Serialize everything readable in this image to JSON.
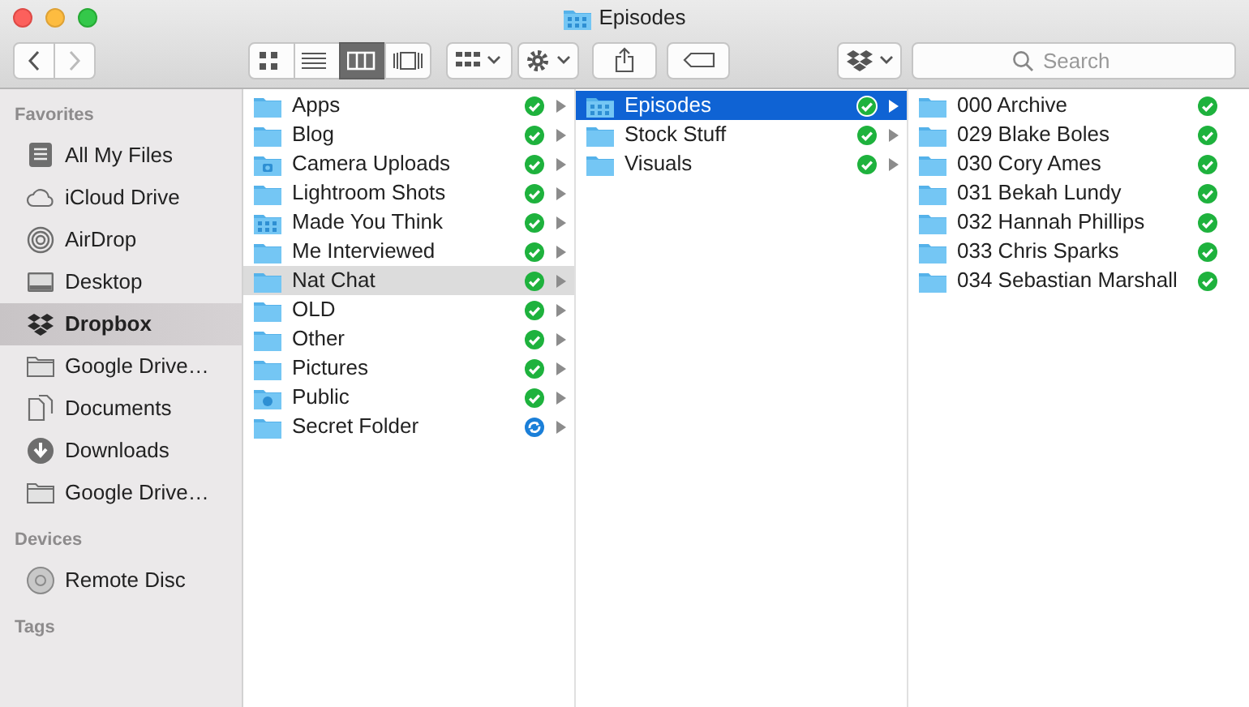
{
  "window": {
    "title": "Episodes"
  },
  "toolbar": {
    "nav": [
      {
        "kind": "back",
        "disabled": false
      },
      {
        "kind": "forward",
        "disabled": true
      }
    ],
    "view_modes": [
      {
        "kind": "icons",
        "selected": false
      },
      {
        "kind": "list",
        "selected": false
      },
      {
        "kind": "columns",
        "selected": true
      },
      {
        "kind": "coverflow",
        "selected": false
      }
    ],
    "buttons": [
      {
        "kind": "arrange"
      },
      {
        "kind": "action"
      },
      {
        "kind": "share"
      },
      {
        "kind": "tag"
      },
      {
        "kind": "dropbox"
      }
    ],
    "search": {
      "placeholder": "Search"
    }
  },
  "sidebar": [
    {
      "heading": "Favorites",
      "items": [
        {
          "label": "All My Files",
          "kind": "files",
          "selected": false
        },
        {
          "label": "iCloud Drive",
          "kind": "cloud",
          "selected": false
        },
        {
          "label": "AirDrop",
          "kind": "airdrop",
          "selected": false
        },
        {
          "label": "Desktop",
          "kind": "desktop",
          "selected": false
        },
        {
          "label": "Dropbox",
          "kind": "dropbox",
          "selected": true
        },
        {
          "label": "Google Drive…",
          "kind": "folder",
          "selected": false
        },
        {
          "label": "Documents",
          "kind": "documents",
          "selected": false
        },
        {
          "label": "Downloads",
          "kind": "downloads",
          "selected": false
        },
        {
          "label": "Google Drive…",
          "kind": "folder",
          "selected": false
        }
      ]
    },
    {
      "heading": "Devices",
      "items": [
        {
          "label": "Remote Disc",
          "kind": "disc",
          "selected": false
        }
      ]
    },
    {
      "heading": "Tags"
    }
  ],
  "columns": [
    {
      "focused": false,
      "items": [
        {
          "name": "Apps",
          "kind": "folder",
          "syncing": false,
          "expandable": true,
          "selected": false
        },
        {
          "name": "Blog",
          "kind": "folder",
          "syncing": false,
          "expandable": true,
          "selected": false
        },
        {
          "name": "Camera Uploads",
          "kind": "camera",
          "syncing": false,
          "expandable": true,
          "selected": false
        },
        {
          "name": "Lightroom Shots",
          "kind": "folder",
          "syncing": false,
          "expandable": true,
          "selected": false
        },
        {
          "name": "Made You Think",
          "kind": "grid",
          "syncing": false,
          "expandable": true,
          "selected": false
        },
        {
          "name": "Me Interviewed",
          "kind": "folder",
          "syncing": false,
          "expandable": true,
          "selected": false
        },
        {
          "name": "Nat Chat",
          "kind": "folder",
          "syncing": false,
          "expandable": true,
          "selected": true
        },
        {
          "name": "OLD",
          "kind": "folder",
          "syncing": false,
          "expandable": true,
          "selected": false
        },
        {
          "name": "Other",
          "kind": "folder",
          "syncing": false,
          "expandable": true,
          "selected": false
        },
        {
          "name": "Pictures",
          "kind": "folder",
          "syncing": false,
          "expandable": true,
          "selected": false
        },
        {
          "name": "Public",
          "kind": "public",
          "syncing": false,
          "expandable": true,
          "selected": false
        },
        {
          "name": "Secret Folder",
          "kind": "folder",
          "syncing": true,
          "expandable": true,
          "selected": false
        }
      ]
    },
    {
      "focused": true,
      "items": [
        {
          "name": "Episodes",
          "kind": "grid",
          "syncing": false,
          "expandable": true,
          "selected": true
        },
        {
          "name": "Stock Stuff",
          "kind": "folder",
          "syncing": false,
          "expandable": true,
          "selected": false
        },
        {
          "name": "Visuals",
          "kind": "folder",
          "syncing": false,
          "expandable": true,
          "selected": false
        }
      ]
    },
    {
      "items": [
        {
          "name": "000 Archive",
          "kind": "folder",
          "syncing": false,
          "expandable": false,
          "selected": false
        },
        {
          "name": "029 Blake Boles",
          "kind": "folder",
          "syncing": false,
          "expandable": false,
          "selected": false
        },
        {
          "name": "030 Cory Ames",
          "kind": "folder",
          "syncing": false,
          "expandable": false,
          "selected": false
        },
        {
          "name": "031 Bekah Lundy",
          "kind": "folder",
          "syncing": false,
          "expandable": false,
          "selected": false
        },
        {
          "name": "032 Hannah Phillips",
          "kind": "folder",
          "syncing": false,
          "expandable": false,
          "selected": false
        },
        {
          "name": "033 Chris Sparks",
          "kind": "folder",
          "syncing": false,
          "expandable": false,
          "selected": false
        },
        {
          "name": "034 Sebastian Marshall",
          "kind": "folder",
          "syncing": false,
          "expandable": false,
          "selected": false
        }
      ]
    }
  ]
}
